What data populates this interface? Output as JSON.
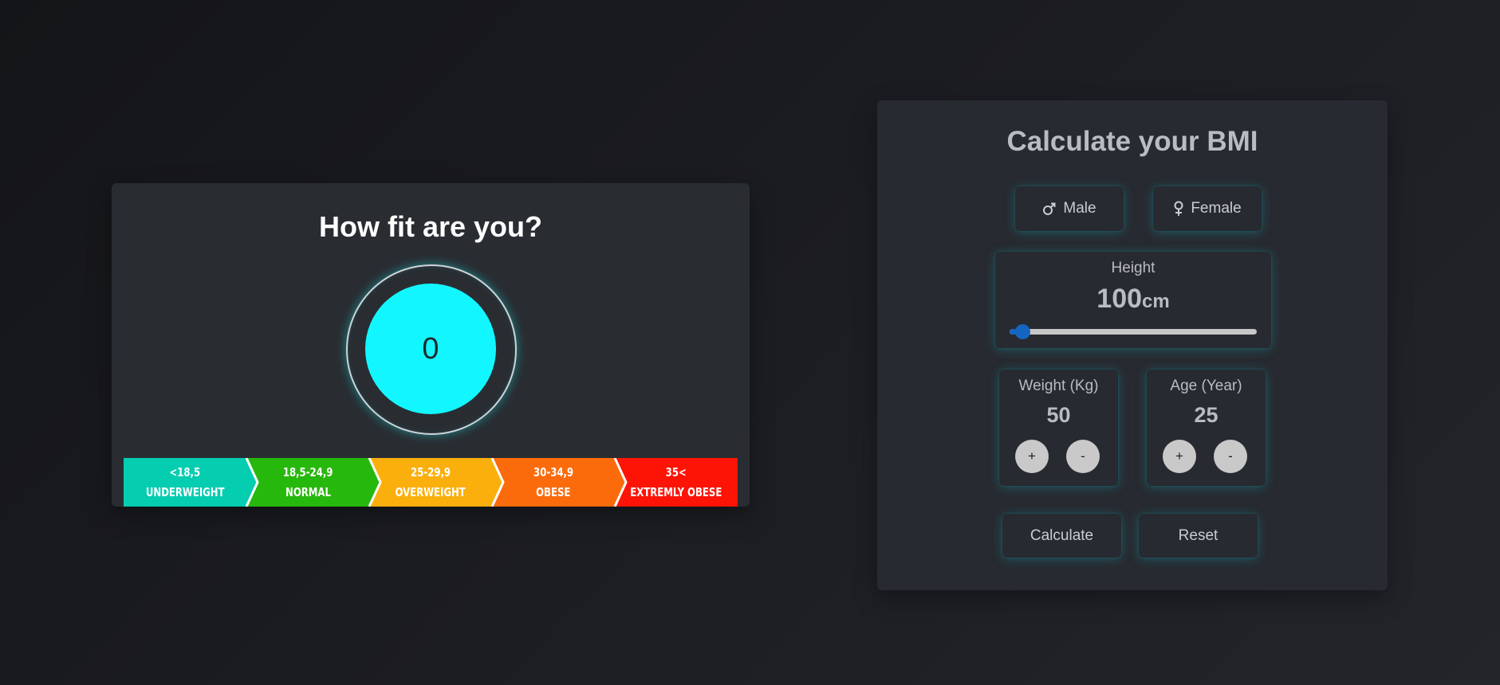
{
  "result": {
    "title": "How fit are you?",
    "bmi_value": "0",
    "scale": [
      {
        "range": "<18,5",
        "label": "UNDERWEIGHT",
        "color": "#05cdb0"
      },
      {
        "range": "18,5-24,9",
        "label": "NORMAL",
        "color": "#27b80d"
      },
      {
        "range": "25-29,9",
        "label": "OVERWEIGHT",
        "color": "#fbaf0c"
      },
      {
        "range": "30-34,9",
        "label": "OBESE",
        "color": "#fb6b0c"
      },
      {
        "range": "35<",
        "label": "EXTREMLY OBESE",
        "color": "#fd1407"
      }
    ],
    "gauge_color": "#12f7ff"
  },
  "calculator": {
    "title": "Calculate your BMI",
    "gender": {
      "male_label": "Male",
      "male_icon": "male-symbol-icon",
      "female_label": "Female",
      "female_icon": "female-symbol-icon"
    },
    "height": {
      "label": "Height",
      "value": "100",
      "unit": "cm",
      "slider_fraction": 0.05,
      "accent": "#1565c0"
    },
    "weight": {
      "label": "Weight (Kg)",
      "value": "50",
      "plus": "+",
      "minus": "-"
    },
    "age": {
      "label": "Age (Year)",
      "value": "25",
      "plus": "+",
      "minus": "-"
    },
    "calculate_label": "Calculate",
    "reset_label": "Reset"
  }
}
